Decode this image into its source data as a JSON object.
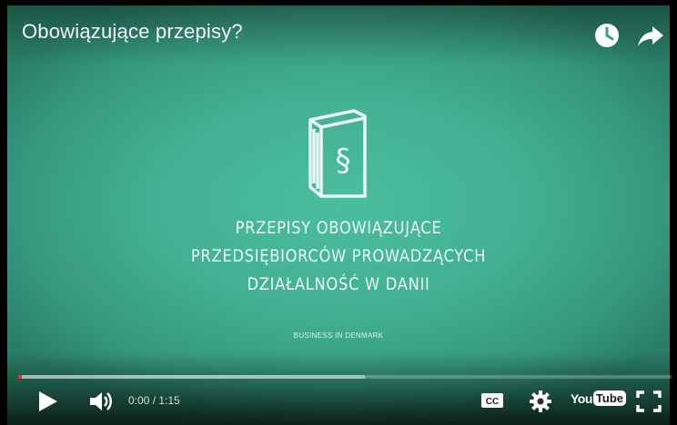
{
  "video": {
    "title": "Obowiązujące przepisy?",
    "headline_lines": [
      "PRZEPISY OBOWIĄZUJĄCE",
      "PRZEDSIĘBIORCÓW PROWADZĄCYCH",
      "DZIAŁALNOŚĆ W DANII"
    ],
    "subtitle": "BUSINESS IN DENMARK",
    "background_color": "#45b597",
    "accent_text_color": "#e9f7f2"
  },
  "controls": {
    "time": "0:00 / 1:15",
    "cc_label": "CC",
    "youtube_logo_you": "You",
    "youtube_logo_tube": "Tube",
    "played_fraction": 0.0,
    "loaded_fraction": 0.53,
    "progress_color": "#ee3322"
  },
  "icons": {
    "top_right": [
      "watch-later-icon",
      "share-icon"
    ],
    "center": "law-book-icon",
    "bottom": [
      "play-icon",
      "volume-icon",
      "closed-captions-icon",
      "settings-icon",
      "youtube-logo",
      "fullscreen-icon"
    ]
  }
}
